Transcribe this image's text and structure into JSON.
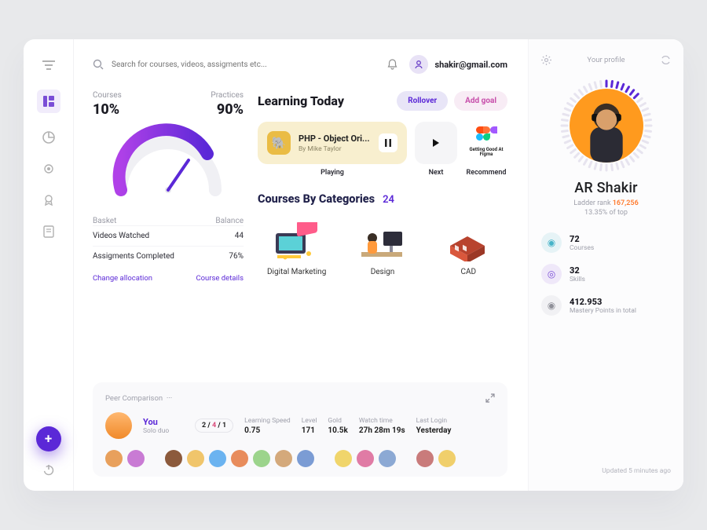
{
  "search": {
    "placeholder": "Search for courses, videos, assigments etc..."
  },
  "user": {
    "email": "shakir@gmail.com"
  },
  "progress": {
    "courses_label": "Courses",
    "practices_label": "Practices",
    "courses_pct": "10%",
    "practices_pct": "90%"
  },
  "basket": {
    "basket_label": "Basket",
    "balance_label": "Balance",
    "rows": [
      {
        "label": "Videos Watched",
        "value": "44"
      },
      {
        "label": "Assigments Completed",
        "value": "76%"
      }
    ],
    "change_label": "Change allocation",
    "details_label": "Course details"
  },
  "learning": {
    "title": "Learning Today",
    "rollover_label": "Rollover",
    "addgoal_label": "Add goal",
    "playing": {
      "title": "PHP - Object Ori...",
      "by": "By Mike Taylor",
      "status": "Playing"
    },
    "next": {
      "status": "Next"
    },
    "recommend": {
      "title": "Getting Good At Figma",
      "status": "Recommend"
    }
  },
  "categories": {
    "title": "Courses By Categories",
    "count": "24",
    "items": [
      {
        "label": "Digital Marketing"
      },
      {
        "label": "Design"
      },
      {
        "label": "CAD"
      }
    ]
  },
  "peer": {
    "title": "Peer Comparison",
    "dots": "···",
    "you": {
      "name": "You",
      "sub": "Solo duo",
      "record": [
        "2",
        "4",
        "1"
      ]
    },
    "stats": {
      "speed_label": "Learning Speed",
      "speed": "0.75",
      "level_label": "Level",
      "level": "171",
      "gold_label": "Gold",
      "gold": "10.5k",
      "watch_label": "Watch time",
      "watch": "27h 28m 19s",
      "login_label": "Last Login",
      "login": "Yesterday"
    }
  },
  "profile": {
    "header": "Your profile",
    "name": "AR Shakir",
    "rank_label": "Ladder rank ",
    "rank_value": "167,256",
    "top_pct": "13.35% of top",
    "stats": [
      {
        "value": "72",
        "label": "Courses",
        "icon": "cat",
        "bg": "#e6f3f6",
        "fg": "#46b3c8"
      },
      {
        "value": "32",
        "label": "Skills",
        "icon": "target",
        "bg": "#efe8f9",
        "fg": "#7a4ed6"
      },
      {
        "value": "412.953",
        "label": "Mastery Points in total",
        "icon": "dot",
        "bg": "#f1f1f4",
        "fg": "#8f9099"
      }
    ],
    "updated": "Updated 5 minutes ago"
  }
}
